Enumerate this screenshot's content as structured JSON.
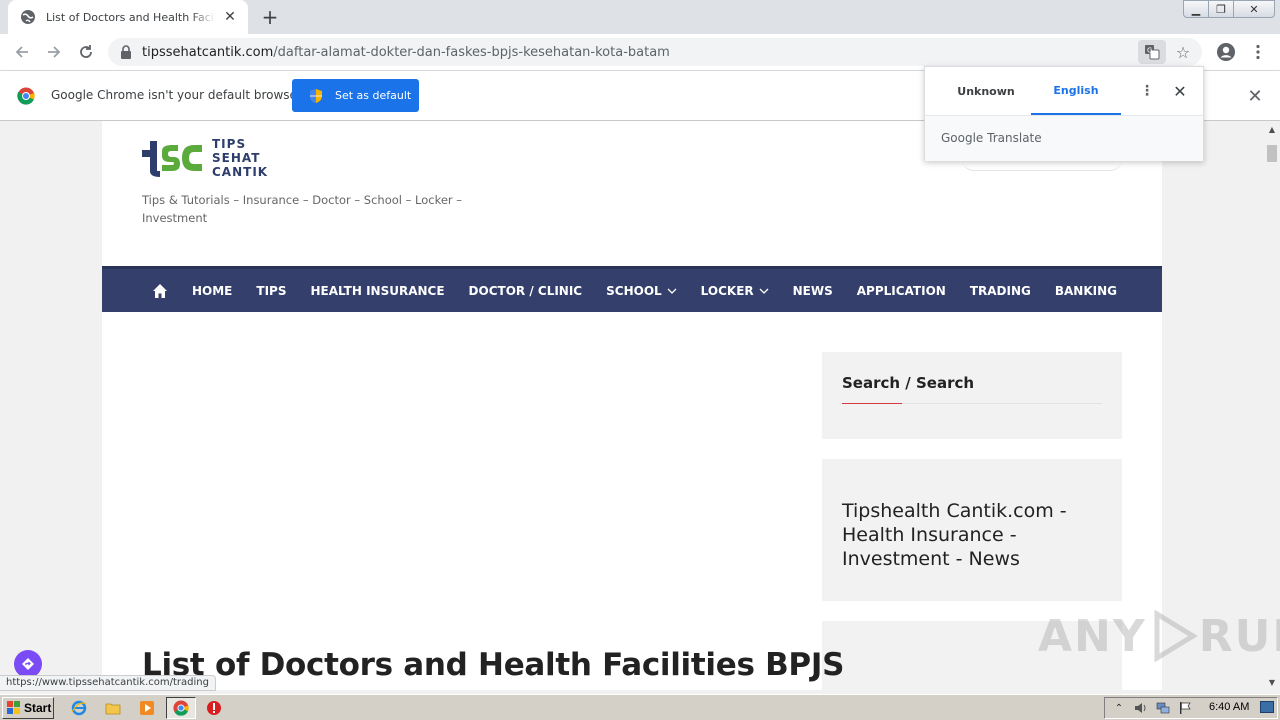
{
  "browser": {
    "tab": {
      "title": "List of Doctors and Health Facilities BPJS",
      "close_glyph": "✕"
    },
    "new_tab_glyph": "+",
    "window_controls": {
      "minimize": "▁",
      "maximize": "❐",
      "close": "✕"
    },
    "address": {
      "domain": "tipssehatcantik.com",
      "path": "/daftar-alamat-dokter-dan-faskes-bpjs-kesehatan-kota-batam"
    },
    "status_url": "https://www.tipssehatcantik.com/trading"
  },
  "infobar": {
    "message": "Google Chrome isn't your default browser",
    "button": "Set as default",
    "close_glyph": "✕"
  },
  "translate_popup": {
    "source_tab": "Unknown",
    "target_tab": "English",
    "more_glyph": "⋮",
    "close_glyph": "✕",
    "brand_google": "Google",
    "brand_translate": " Translate"
  },
  "site": {
    "logo_text": [
      "TIPS",
      "SEHAT",
      "CANTIK"
    ],
    "tagline": "Tips & Tutorials – Insurance – Doctor – School – Locker – Investment",
    "nav": [
      {
        "label": "HOME",
        "dropdown": false
      },
      {
        "label": "TIPS",
        "dropdown": false
      },
      {
        "label": "HEALTH INSURANCE",
        "dropdown": false
      },
      {
        "label": "DOCTOR / CLINIC",
        "dropdown": false
      },
      {
        "label": "SCHOOL",
        "dropdown": true
      },
      {
        "label": "LOCKER",
        "dropdown": true
      },
      {
        "label": "NEWS",
        "dropdown": false
      },
      {
        "label": "APPLICATION",
        "dropdown": false
      },
      {
        "label": "TRADING",
        "dropdown": false
      },
      {
        "label": "BANKING",
        "dropdown": false
      }
    ],
    "sidebar": {
      "search_title": "Search / Search",
      "promo_text": "Tipshealth Cantik.com - Health Insurance - Investment - News"
    },
    "article_heading": "List of Doctors and Health Facilities BPJS"
  },
  "watermark": {
    "left": "ANY",
    "right": "RUN"
  },
  "taskbar": {
    "start_label": "Start",
    "clock": "6:40 AM"
  },
  "colors": {
    "nav_bg": "#34406b",
    "accent_blue": "#1a73e8",
    "logo_green": "#5aab3c",
    "logo_navy": "#2d3e6d",
    "widget_accent": "#d63a3a"
  }
}
